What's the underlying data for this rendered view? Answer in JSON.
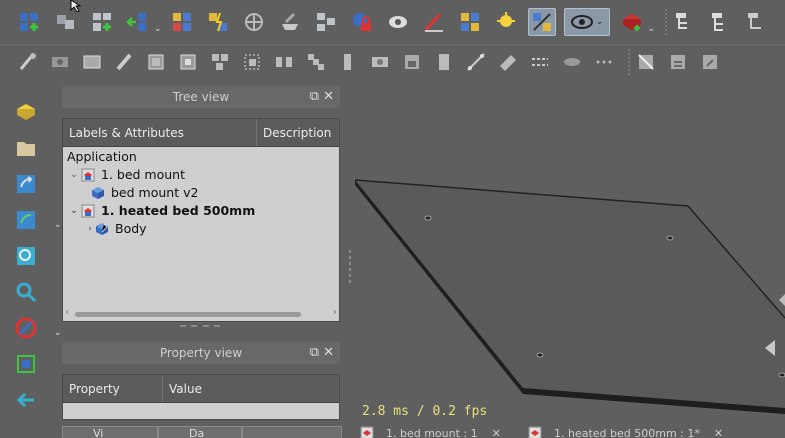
{
  "tree_view": {
    "title": "Tree view",
    "columns": [
      "Labels & Attributes",
      "Description"
    ],
    "root": "Application",
    "items": [
      {
        "label": "1. bed mount",
        "level": 1,
        "expanded": true,
        "bold": false
      },
      {
        "label": "bed mount v2",
        "level": 2,
        "expanded": false,
        "bold": false
      },
      {
        "label": "1. heated bed 500mm",
        "level": 1,
        "expanded": true,
        "bold": true
      },
      {
        "label": "Body",
        "level": 2,
        "expanded": false,
        "bold": false
      }
    ]
  },
  "property_view": {
    "title": "Property view",
    "columns": [
      "Property",
      "Value"
    ]
  },
  "status": {
    "fps": "2.8 ms / 0.2 fps"
  },
  "tabs": {
    "left_tab_1": "Vi",
    "left_tab_2": "Da",
    "doc_tab_1": "1. bed mount : 1",
    "doc_tab_2": "1. heated bed 500mm : 1*"
  },
  "toolbar_icons": {
    "row1": [
      "new-part-icon",
      "copy-icon",
      "assembly-icon",
      "move-icon",
      "parts-icon",
      "constraints-icon",
      "joint-icon",
      "measure-icon",
      "bom-icon",
      "lock-icon",
      "visibility-icon",
      "sketch-icon",
      "group-icon",
      "light-icon",
      "selection-filter-icon",
      "eye-icon",
      "add-body-icon",
      "tree-icon",
      "tree-expand-icon",
      "tree-collapse-icon"
    ],
    "row2_count": 23
  },
  "colors": {
    "background": "#5f5f5f",
    "panel": "#cfcfcf",
    "fps_text": "#e8e07a"
  }
}
